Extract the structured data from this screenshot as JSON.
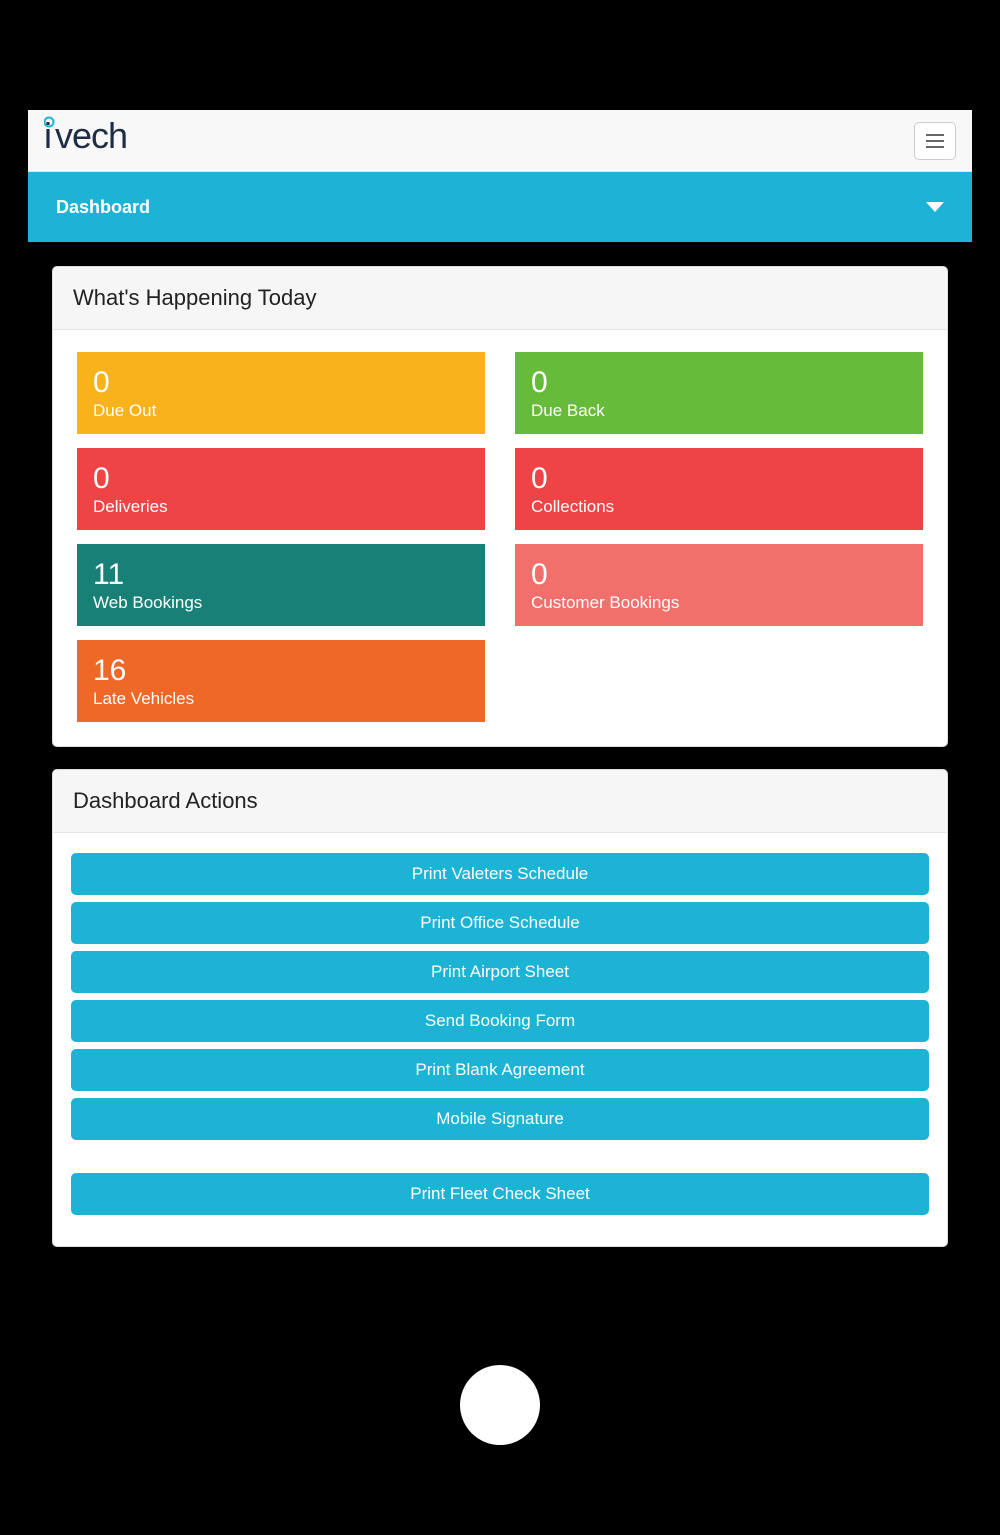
{
  "brand": "ivech",
  "breadcrumb": {
    "title": "Dashboard"
  },
  "panels": {
    "happening": {
      "title": "What's Happening Today",
      "cards": [
        {
          "value": "0",
          "label": "Due Out",
          "color": "#f8b21c"
        },
        {
          "value": "0",
          "label": "Due Back",
          "color": "#66bb3b"
        },
        {
          "value": "0",
          "label": "Deliveries",
          "color": "#ee4445"
        },
        {
          "value": "0",
          "label": "Collections",
          "color": "#ee4445"
        },
        {
          "value": "11",
          "label": "Web Bookings",
          "color": "#198077"
        },
        {
          "value": "0",
          "label": "Customer Bookings",
          "color": "#f2706c"
        },
        {
          "value": "16",
          "label": "Late Vehicles",
          "color": "#ee6827"
        }
      ]
    },
    "actions": {
      "title": "Dashboard Actions",
      "buttons": [
        "Print Valeters Schedule",
        "Print Office Schedule",
        "Print Airport Sheet",
        "Send Booking Form",
        "Print Blank Agreement",
        "Mobile Signature"
      ],
      "secondary_buttons": [
        "Print Fleet Check Sheet"
      ]
    }
  },
  "colors": {
    "accent": "#1cb3d4"
  }
}
